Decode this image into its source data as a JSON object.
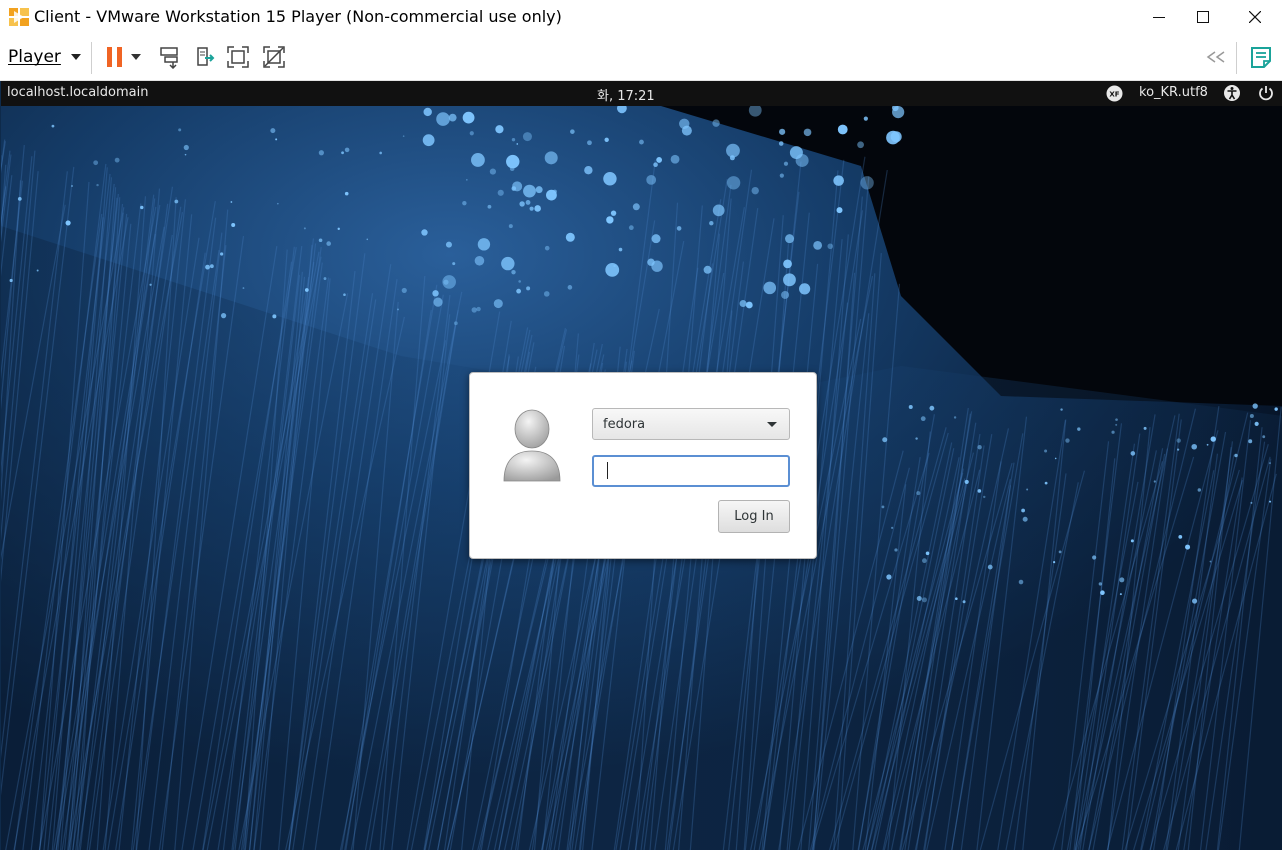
{
  "window": {
    "title": "Client - VMware Workstation 15 Player (Non-commercial use only)",
    "controls": {
      "minimize": "minimize-icon",
      "maximize": "maximize-icon",
      "close": "close-icon"
    }
  },
  "toolbar": {
    "player_menu": "Player",
    "icons": [
      "pause-icon",
      "dropdown-arrow-icon",
      "send-ctrl-alt-del-icon",
      "removable-devices-icon",
      "fullscreen-icon",
      "unity-icon",
      "collapse-icon",
      "notes-icon"
    ],
    "colors": {
      "pause": "#f06424",
      "accent": "#1aa39a"
    }
  },
  "guest": {
    "topbar": {
      "hostname": "localhost.localdomain",
      "clock": "화, 17:21",
      "input_method_icon": "xf-input-icon",
      "locale": "ko_KR.utf8",
      "accessibility_icon": "accessibility-icon",
      "power_icon": "power-icon"
    },
    "login": {
      "user_icon": "user-avatar-icon",
      "selected_user": "fedora",
      "password_value": "",
      "login_button": "Log In",
      "focus_color": "#5b8fd3"
    }
  }
}
